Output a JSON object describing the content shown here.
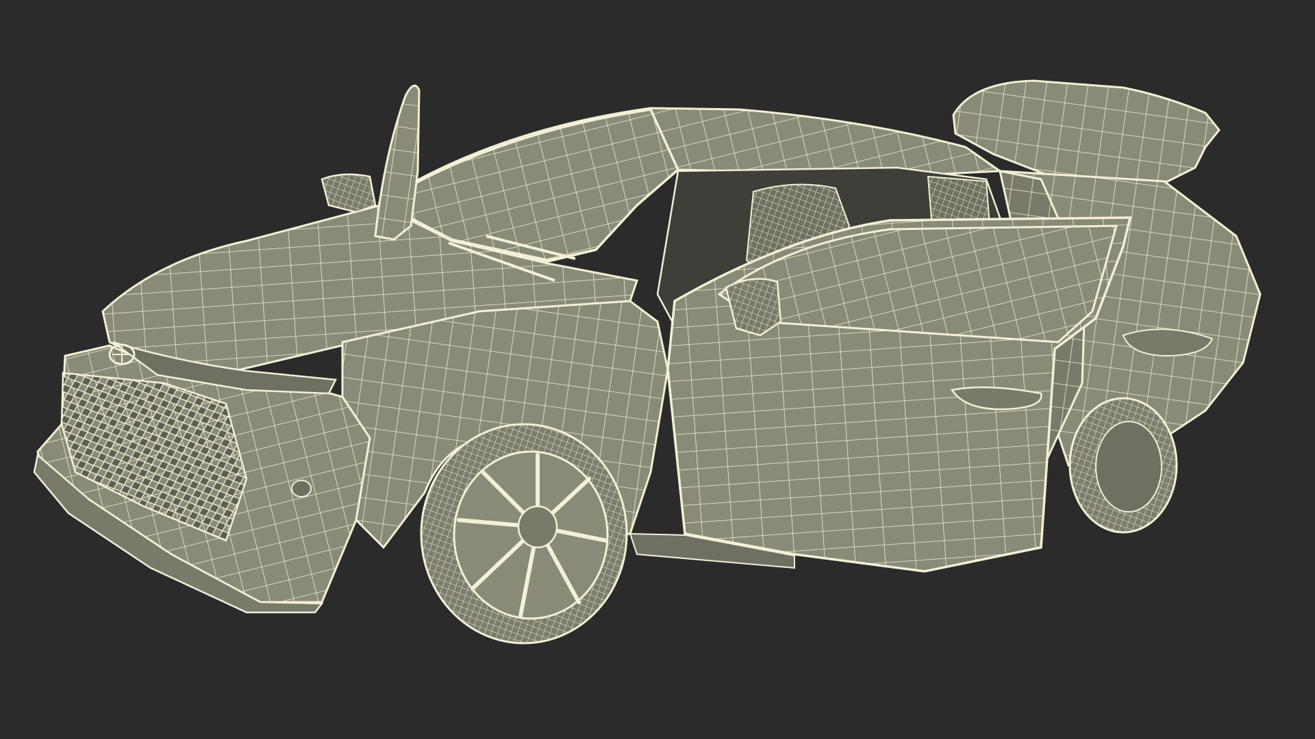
{
  "scene": {
    "subject": "car-wireframe-render",
    "colors": {
      "background": "#2b2b2b",
      "surface": "#8a8a78",
      "surface_shadow": "#6f6f62",
      "surface_light": "#a3a390",
      "wire": "#f2f0d6",
      "tire": "#7d7d6e",
      "glass_dark": "#3f3f39"
    }
  }
}
